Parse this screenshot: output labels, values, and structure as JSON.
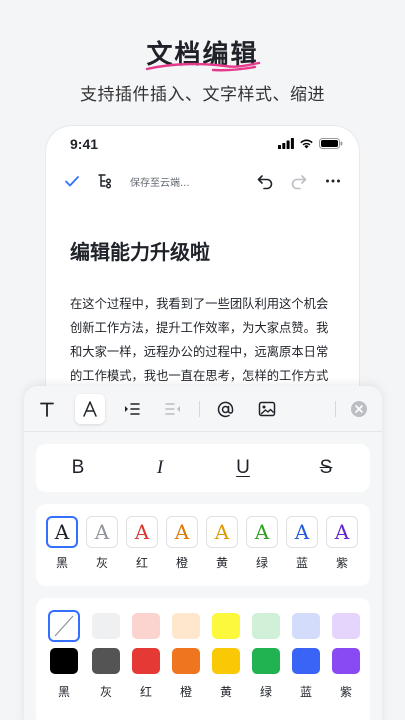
{
  "promo": {
    "title": "文档编辑",
    "subtitle": "支持插件插入、文字样式、缩进"
  },
  "status_bar": {
    "time": "9:41",
    "icons": [
      "cellular-signal-icon",
      "wifi-icon",
      "battery-icon"
    ]
  },
  "toolbar": {
    "done_icon": "check-icon",
    "outline_icon": "outline-tree-icon",
    "save_status": "保存至云端...",
    "undo_icon": "undo-icon",
    "redo_icon": "redo-icon",
    "more_icon": "more-horizontal-icon"
  },
  "document": {
    "title": "编辑能力升级啦",
    "body_lines": [
      "在这个过程中，我看到了一些团队利用这个机会",
      "创新工作方法，提升工作效率，为大家点赞。我",
      "和大家一样，远程办公的过程中，远离原本日常",
      "的工作模式，我也一直在思考，怎样的工作方式"
    ]
  },
  "format_bar": {
    "items": [
      "text-type-icon",
      "text-color-icon",
      "indent-increase-icon",
      "indent-decrease-icon",
      "mention-icon",
      "image-icon",
      "close-circle-icon"
    ]
  },
  "text_styles": {
    "bold": "B",
    "italic": "I",
    "underline": "U",
    "strikethrough": "S"
  },
  "text_colors": {
    "glyph": "A",
    "items": [
      {
        "label": "黑",
        "color": "#1f2329"
      },
      {
        "label": "灰",
        "color": "#8f959e"
      },
      {
        "label": "红",
        "color": "#d83931"
      },
      {
        "label": "橙",
        "color": "#de7802"
      },
      {
        "label": "黄",
        "color": "#dc9b04"
      },
      {
        "label": "绿",
        "color": "#2ea121"
      },
      {
        "label": "蓝",
        "color": "#245bdb"
      },
      {
        "label": "紫",
        "color": "#6425d0"
      }
    ]
  },
  "background_colors": {
    "light": [
      "none",
      "#eff0f1",
      "#fbd4d0",
      "#fee7cd",
      "#fcf83e",
      "#d0f0d8",
      "#d4dcfb",
      "#e5d4fb"
    ],
    "dark": [
      "#000000",
      "#545454",
      "#e53935",
      "#f0751f",
      "#fac905",
      "#21b351",
      "#3a64f5",
      "#8a4af3"
    ],
    "labels": [
      "黑",
      "灰",
      "红",
      "橙",
      "黄",
      "绿",
      "蓝",
      "紫"
    ]
  },
  "accent_color": "#3370ff",
  "brand_underline_color": "#e5398b"
}
